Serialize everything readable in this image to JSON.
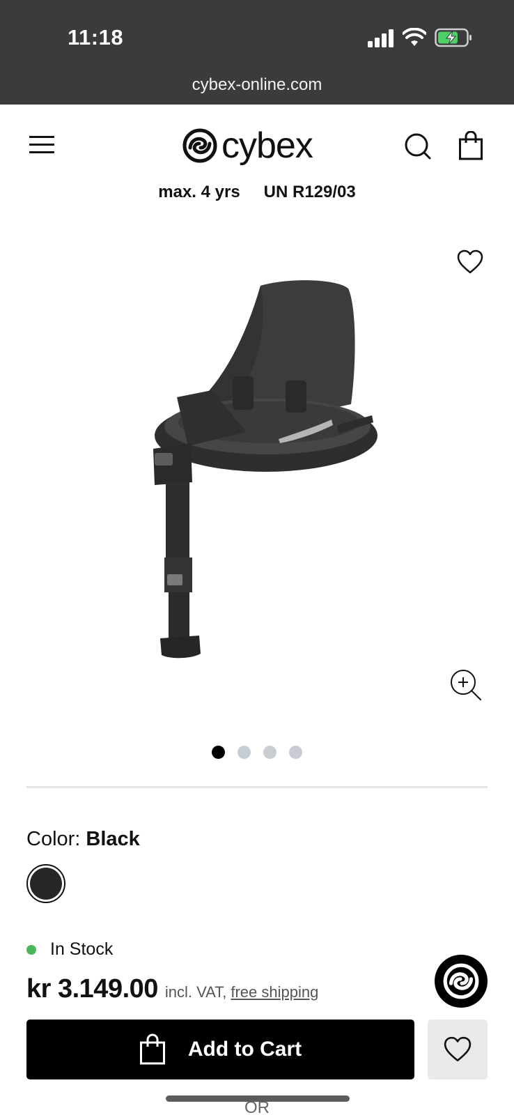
{
  "status_bar": {
    "time": "11:18",
    "icons": [
      "cellular-signal-icon",
      "wifi-icon",
      "battery-charging-icon"
    ]
  },
  "browser": {
    "url": "cybex-online.com"
  },
  "header": {
    "brand": "cybex",
    "icons": [
      "hamburger-menu-icon",
      "cybex-logo-mark",
      "search-icon",
      "shopping-bag-icon"
    ]
  },
  "specs": {
    "age": "max. 4 yrs",
    "standard": "UN R129/03"
  },
  "gallery": {
    "image_count": 4,
    "active_index": 0,
    "icons": [
      "heart-icon",
      "zoom-in-icon"
    ]
  },
  "product": {
    "color_label": "Color:",
    "color_value": "Black",
    "swatch_color": "#262626",
    "stock_text": "In Stock",
    "stock_color": "#4cb75a",
    "price": "kr 3.149.00",
    "price_note": "incl. VAT,",
    "shipping_link": "free shipping"
  },
  "actions": {
    "add_to_cart": "Add to Cart",
    "or_text": "OR"
  }
}
